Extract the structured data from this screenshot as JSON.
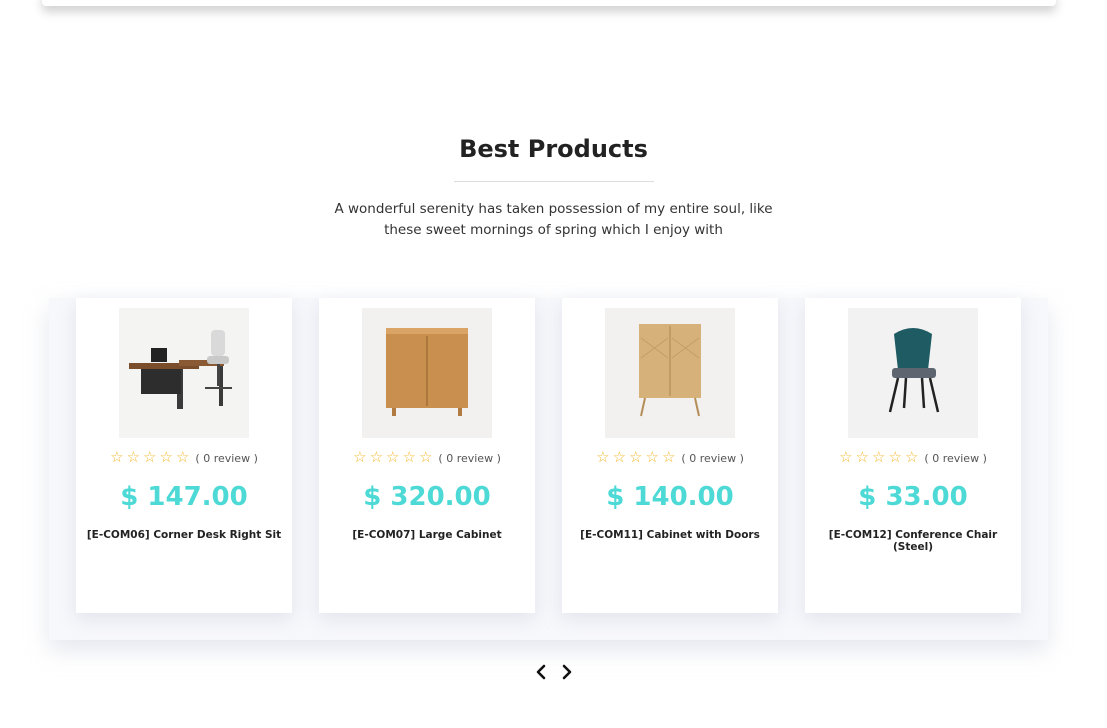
{
  "section": {
    "title": "Best Products",
    "subtitle": "A wonderful serenity has taken possession of my entire soul, like these sweet mornings of spring which I enjoy with"
  },
  "colors": {
    "price": "#4dd9d5",
    "star": "#f5b82e",
    "title": "#222222"
  },
  "star_glyph": "☆",
  "products": [
    {
      "image": "office-desk-image",
      "rating": 0,
      "review_label": "( 0 review )",
      "price": "$ 147.00",
      "name": "[E-COM06] Corner Desk Right Sit"
    },
    {
      "image": "large-cabinet-image",
      "rating": 0,
      "review_label": "( 0 review )",
      "price": "$ 320.00",
      "name": "[E-COM07] Large Cabinet"
    },
    {
      "image": "cabinet-doors-image",
      "rating": 0,
      "review_label": "( 0 review )",
      "price": "$ 140.00",
      "name": "[E-COM11] Cabinet with Doors"
    },
    {
      "image": "conference-chair-image",
      "rating": 0,
      "review_label": "( 0 review )",
      "price": "$ 33.00",
      "name": "[E-COM12] Conference Chair (Steel)"
    }
  ],
  "navigation": {
    "prev_icon": "chevron-left-icon",
    "next_icon": "chevron-right-icon"
  }
}
